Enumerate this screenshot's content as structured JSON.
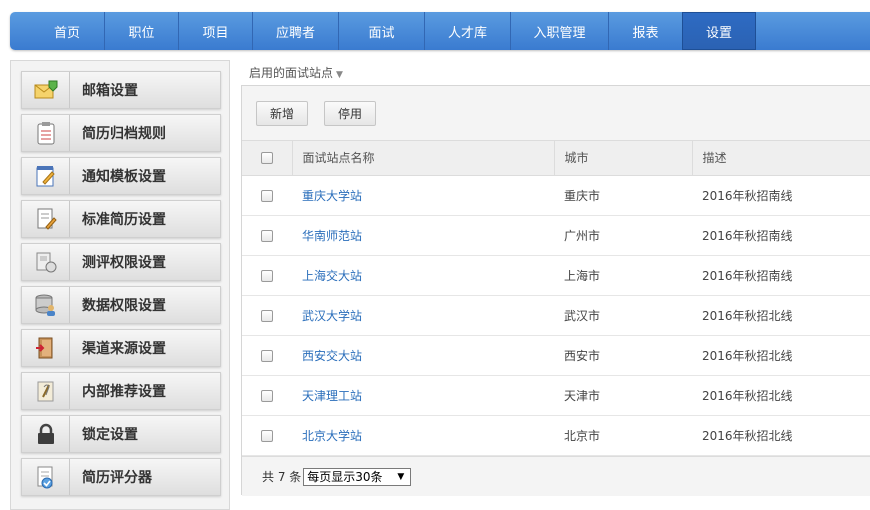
{
  "nav": {
    "items": [
      {
        "label": "首页"
      },
      {
        "label": "职位"
      },
      {
        "label": "项目"
      },
      {
        "label": "应聘者"
      },
      {
        "label": "面试"
      },
      {
        "label": "人才库"
      },
      {
        "label": "入职管理"
      },
      {
        "label": "报表"
      },
      {
        "label": "设置"
      }
    ],
    "active_index": 8
  },
  "sidebar": {
    "items": [
      {
        "label": "邮箱设置",
        "icon": "mail-settings-icon"
      },
      {
        "label": "简历归档规则",
        "icon": "clipboard-icon"
      },
      {
        "label": "通知模板设置",
        "icon": "notepad-pencil-icon"
      },
      {
        "label": "标准简历设置",
        "icon": "document-edit-icon"
      },
      {
        "label": "测评权限设置",
        "icon": "assessment-icon"
      },
      {
        "label": "数据权限设置",
        "icon": "database-user-icon"
      },
      {
        "label": "渠道来源设置",
        "icon": "door-exit-icon"
      },
      {
        "label": "内部推荐设置",
        "icon": "paperclip-note-icon"
      },
      {
        "label": "锁定设置",
        "icon": "lock-icon"
      },
      {
        "label": "简历评分器",
        "icon": "document-check-icon"
      }
    ]
  },
  "main": {
    "breadcrumb": "启用的面试站点",
    "toolbar": {
      "add_label": "新增",
      "disable_label": "停用"
    },
    "table": {
      "columns": [
        "面试站点名称",
        "城市",
        "描述"
      ],
      "rows": [
        {
          "name": "重庆大学站",
          "city": "重庆市",
          "desc": "2016年秋招南线"
        },
        {
          "name": "华南师范站",
          "city": "广州市",
          "desc": "2016年秋招南线"
        },
        {
          "name": "上海交大站",
          "city": "上海市",
          "desc": "2016年秋招南线"
        },
        {
          "name": "武汉大学站",
          "city": "武汉市",
          "desc": "2016年秋招北线"
        },
        {
          "name": "西安交大站",
          "city": "西安市",
          "desc": "2016年秋招北线"
        },
        {
          "name": "天津理工站",
          "city": "天津市",
          "desc": "2016年秋招北线"
        },
        {
          "name": "北京大学站",
          "city": "北京市",
          "desc": "2016年秋招北线"
        }
      ]
    },
    "footer": {
      "total_text": "共 7 条",
      "page_size_option": "每页显示30条"
    }
  },
  "colors": {
    "nav": "#4a8bd8",
    "nav_active": "#2b62b3",
    "link": "#2a6ebb"
  }
}
